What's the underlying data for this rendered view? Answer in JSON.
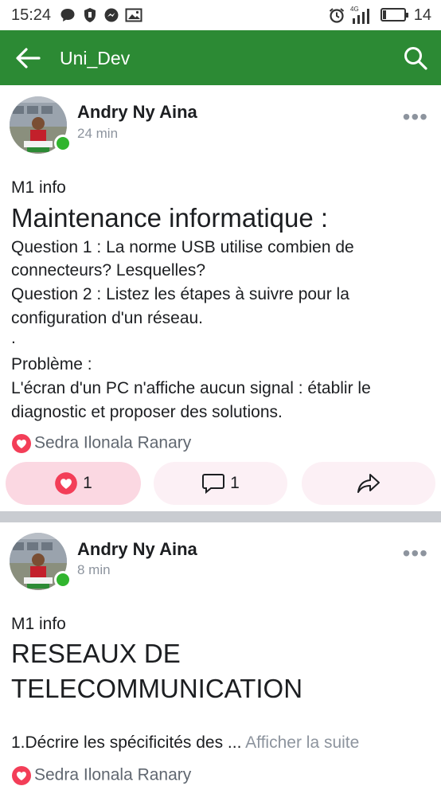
{
  "status_bar": {
    "time": "15:24",
    "network": "4G",
    "battery": "14"
  },
  "app_bar": {
    "title": "Uni_Dev"
  },
  "posts": [
    {
      "author": "Andry Ny Aina",
      "time": "24 min",
      "group_tag": "M1 info",
      "title": "Maintenance informatique :",
      "body": [
        "Question 1 : La norme USB utilise combien de",
        "connecteurs? Lesquelles?",
        "Question 2 : Listez les étapes à suivre pour la",
        "configuration d'un réseau.",
        ".",
        "Problème :",
        "L'écran d'un PC n'affiche aucun signal : établir le",
        "diagnostic et proposer des solutions."
      ],
      "reactor": "Sedra Ilonala Ranary",
      "like_count": "1",
      "comment_count": "1"
    },
    {
      "author": "Andry Ny Aina",
      "time": "8 min",
      "group_tag": "M1 info",
      "title_lines": [
        "RESEAUX DE",
        "TELECOMMUNICATION"
      ],
      "body_preview": "1.Décrire les spécificités des ...",
      "see_more": "Afficher la suite",
      "reactor": "Sedra Ilonala Ranary"
    }
  ],
  "colors": {
    "app_bar": "#2c8a34",
    "online": "#31b52e",
    "love": "#f33e58",
    "like_pill": "#fbd8e2"
  },
  "icons": {
    "back": "arrow-left-icon",
    "search": "search-icon",
    "more": "more-horizontal-icon",
    "heart": "heart-icon",
    "comment": "comment-icon",
    "share": "share-icon"
  }
}
